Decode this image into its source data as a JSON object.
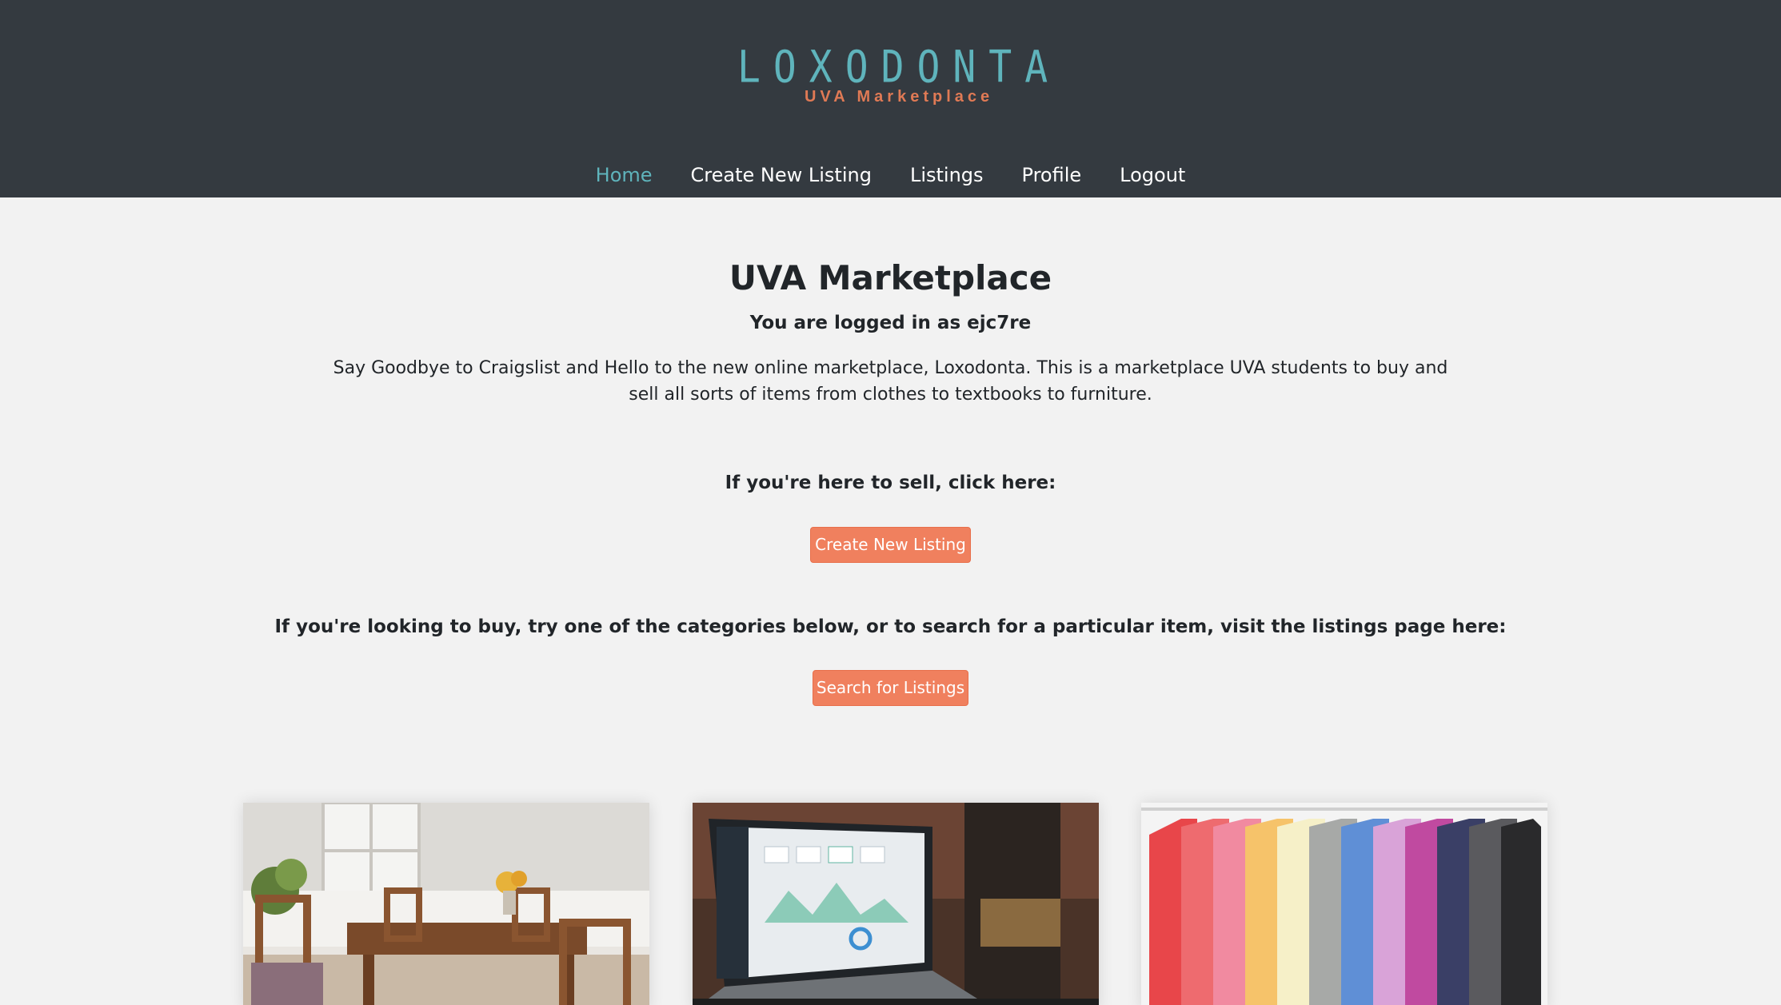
{
  "brand": {
    "logo_title": "LOXODONTA",
    "logo_subtitle": "UVA Marketplace",
    "logo_teal": "#5fb4bc",
    "logo_orange": "#e07a55"
  },
  "nav": {
    "items": [
      {
        "label": "Home",
        "active": true
      },
      {
        "label": "Create New Listing",
        "active": false
      },
      {
        "label": "Listings",
        "active": false
      },
      {
        "label": "Profile",
        "active": false
      },
      {
        "label": "Logout",
        "active": false
      }
    ]
  },
  "main": {
    "title": "UVA Marketplace",
    "login_status": "You are logged in as ejc7re",
    "description": "Say Goodbye to Craigslist and Hello to the new online marketplace, Loxodonta. This is a marketplace UVA students to buy and sell all sorts of items from clothes to textbooks to furniture.",
    "sell_prompt": "If you're here to sell, click here:",
    "create_button": "Create New Listing",
    "buy_prompt": "If you're looking to buy, try one of the categories below, or to search for a particular item, visit the listings page here:",
    "search_button": "Search for Listings"
  },
  "categories": [
    {
      "image": "dining-table-photo"
    },
    {
      "image": "laptop-photo"
    },
    {
      "image": "tshirts-photo"
    }
  ],
  "colors": {
    "header_bg": "#343a40",
    "page_bg": "#f2f2f2",
    "button_bg": "#f0805e",
    "nav_active": "#5fb4bc"
  }
}
